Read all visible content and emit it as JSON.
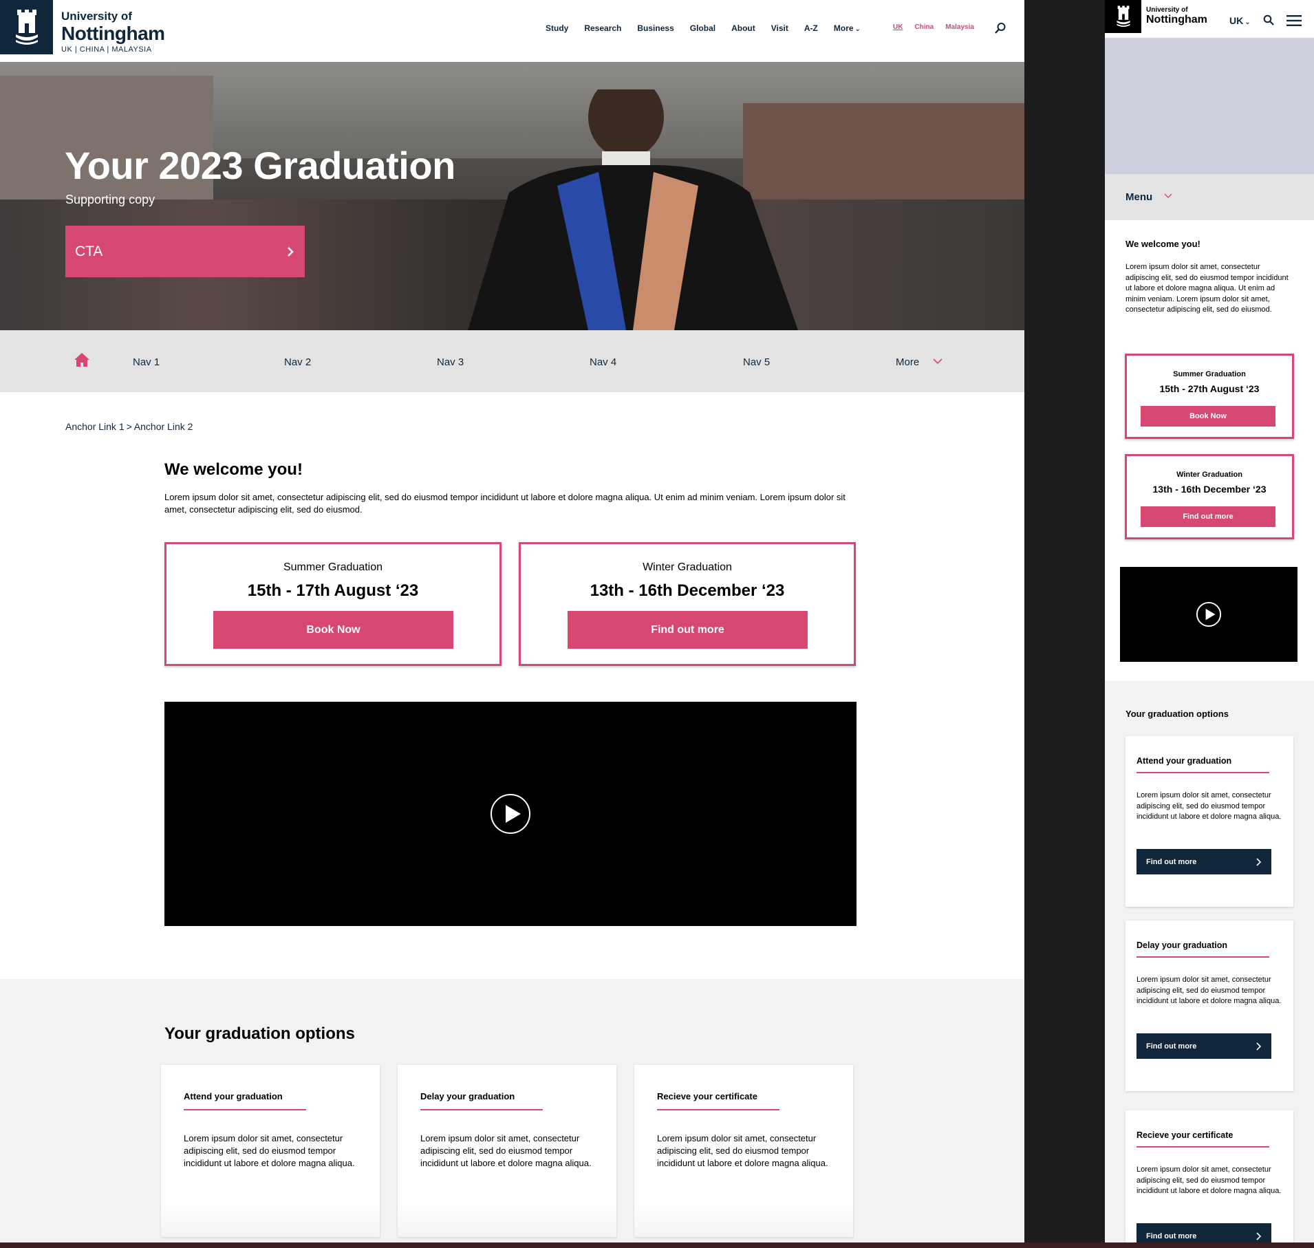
{
  "colors": {
    "brand_navy": "#10263b",
    "accent_pink": "#d64772",
    "nav_grey": "#e3e3e3",
    "section_grey": "#f2f2f2"
  },
  "desktop": {
    "logo": {
      "line1": "University of",
      "line2": "Nottingham",
      "line3": "UK | CHINA | MALAYSIA"
    },
    "top_nav": [
      "Study",
      "Research",
      "Business",
      "Global",
      "About",
      "Visit",
      "A-Z",
      "More"
    ],
    "regions": [
      "UK",
      "China",
      "Malaysia"
    ],
    "hero": {
      "title": "Your 2023 Graduation",
      "subtitle": "Supporting copy",
      "cta": "CTA"
    },
    "sub_nav": [
      "Nav 1",
      "Nav 2",
      "Nav 3",
      "Nav 4",
      "Nav 5",
      "More"
    ],
    "breadcrumb": [
      "Anchor Link 1",
      ">",
      "Anchor Link 2"
    ],
    "welcome": {
      "heading": "We welcome you!",
      "body": "Lorem ipsum dolor sit amet, consectetur adipiscing elit, sed do eiusmod tempor incididunt ut labore et dolore magna aliqua. Ut enim ad minim veniam. Lorem ipsum dolor sit amet, consectetur adipiscing elit, sed do eiusmod."
    },
    "cards": [
      {
        "title": "Summer Graduation",
        "date": "15th - 17th August ‘23",
        "button": "Book Now"
      },
      {
        "title": "Winter Graduation",
        "date": "13th - 16th December ‘23",
        "button": "Find out more"
      }
    ],
    "options": {
      "heading": "Your graduation options",
      "items": [
        {
          "title": "Attend your graduation",
          "body": "Lorem ipsum dolor sit amet, consectetur adipiscing elit, sed do eiusmod tempor incididunt ut labore et dolore magna aliqua."
        },
        {
          "title": "Delay your graduation",
          "body": "Lorem ipsum dolor sit amet, consectetur adipiscing elit, sed do eiusmod tempor incididunt ut labore et dolore magna aliqua."
        },
        {
          "title": "Recieve your certificate",
          "body": "Lorem ipsum dolor sit amet, consectetur adipiscing elit, sed do eiusmod tempor incididunt ut labore et dolore magna aliqua."
        }
      ]
    }
  },
  "mobile": {
    "logo": {
      "line1": "University of",
      "line2": "Nottingham"
    },
    "region": "UK",
    "menu": "Menu",
    "welcome": {
      "heading": "We welcome you!",
      "body": "Lorem ipsum dolor sit amet, consectetur adipiscing elit, sed do eiusmod tempor incididunt ut labore et dolore magna aliqua. Ut enim ad minim veniam. Lorem ipsum dolor sit amet, consectetur adipiscing elit, sed do eiusmod."
    },
    "cards": [
      {
        "title": "Summer Graduation",
        "date": "15th - 27th August ‘23",
        "button": "Book Now"
      },
      {
        "title": "Winter Graduation",
        "date": "13th - 16th December ‘23",
        "button": "Find out more"
      }
    ],
    "options": {
      "heading": "Your graduation options",
      "items": [
        {
          "title": "Attend your graduation",
          "body": "Lorem ipsum dolor sit amet, consectetur adipiscing elit, sed do eiusmod tempor incididunt ut labore et dolore magna aliqua.",
          "button": "Find out more"
        },
        {
          "title": "Delay your graduation",
          "body": "Lorem ipsum dolor sit amet, consectetur adipiscing elit, sed do eiusmod tempor incididunt ut labore et dolore magna aliqua.",
          "button": "Find out more"
        },
        {
          "title": "Recieve your certificate",
          "body": "Lorem ipsum dolor sit amet, consectetur adipiscing elit, sed do eiusmod tempor incididunt ut labore et dolore magna aliqua.",
          "button": "Find out more"
        }
      ]
    }
  }
}
